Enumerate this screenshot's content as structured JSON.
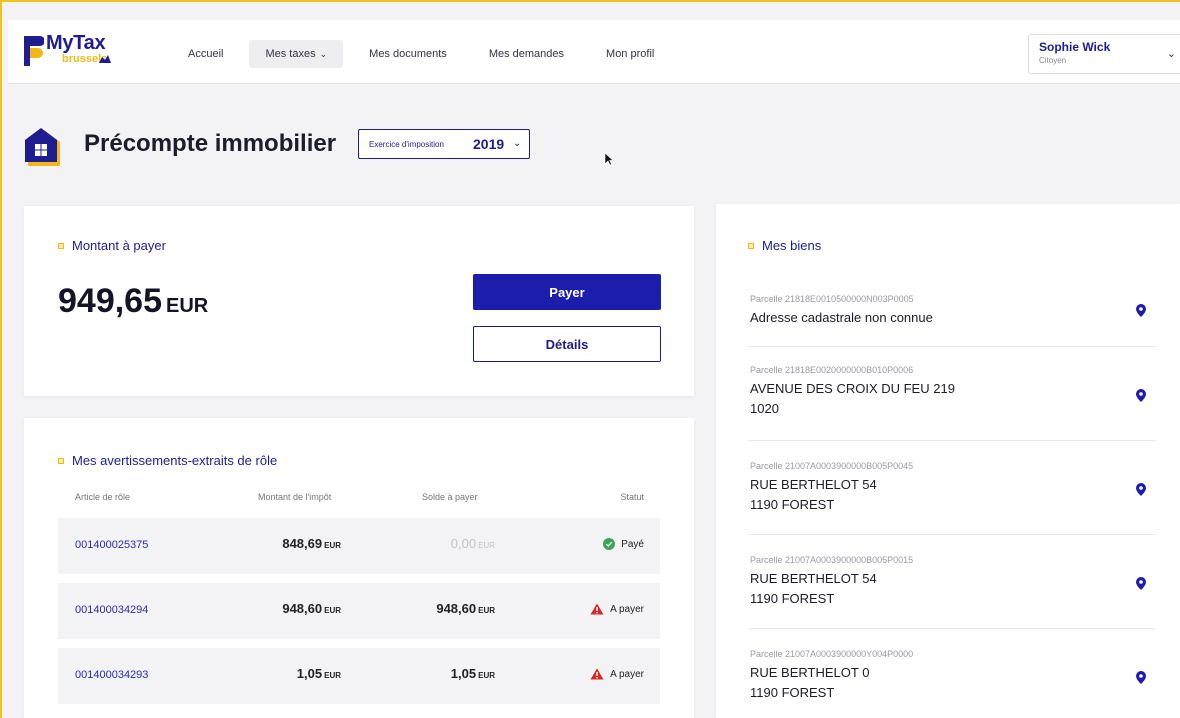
{
  "app": {
    "logo_main": "MyTax",
    "logo_sub": "brussels"
  },
  "nav": {
    "items": [
      {
        "label": "Accueil"
      },
      {
        "label": "Mes taxes"
      },
      {
        "label": "Mes documents"
      },
      {
        "label": "Mes demandes"
      },
      {
        "label": "Mon profil"
      }
    ]
  },
  "user": {
    "name": "Sophie Wick",
    "role": "Citoyen"
  },
  "page": {
    "title": "Précompte immobilier",
    "year_label": "Exercice d'imposition",
    "year_value": "2019"
  },
  "amount_card": {
    "title": "Montant à payer",
    "value": "949,65",
    "currency": "EUR",
    "pay_label": "Payer",
    "details_label": "Détails"
  },
  "role_card": {
    "title": "Mes avertissements-extraits de rôle",
    "columns": [
      "Article de rôle",
      "Montant de l'impôt",
      "Solde à payer",
      "Statut"
    ],
    "rows": [
      {
        "article": "001400025375",
        "montant": "848,69",
        "montant_unit": "EUR",
        "solde": "0,00",
        "solde_unit": "EUR",
        "statut": "Payé"
      },
      {
        "article": "001400034294",
        "montant": "948,60",
        "montant_unit": "EUR",
        "solde": "948,60",
        "solde_unit": "EUR",
        "statut": "A payer"
      },
      {
        "article": "001400034293",
        "montant": "1,05",
        "montant_unit": "EUR",
        "solde": "1,05",
        "solde_unit": "EUR",
        "statut": "A payer"
      }
    ]
  },
  "biens_card": {
    "title": "Mes biens",
    "items": [
      {
        "parcel": "Parcelle 21818E0010500000N003P0005",
        "line1": "Adresse cadastrale non connue",
        "line2": ""
      },
      {
        "parcel": "Parcelle 21818E0020000000B010P0006",
        "line1": "AVENUE DES CROIX DU FEU 219",
        "line2": "1020"
      },
      {
        "parcel": "Parcelle 21007A0003900000B005P0045",
        "line1": "RUE BERTHELOT 54",
        "line2": "1190 FOREST"
      },
      {
        "parcel": "Parcelle 21007A0003900000B005P0015",
        "line1": "RUE BERTHELOT 54",
        "line2": "1190 FOREST"
      },
      {
        "parcel": "Parcelle 21007A0003900000Y004P0000",
        "line1": "RUE BERTHELOT 0",
        "line2": "1190 FOREST"
      }
    ]
  },
  "colors": {
    "brand_blue": "#1d1dac",
    "accent_yellow": "#f0b81b",
    "paid_green": "#3aa655",
    "warning_red": "#d42a2a"
  },
  "icons": {
    "logo": "mytax-logo-icon",
    "house": "house-icon",
    "pin": "location-pin-icon",
    "paid": "check-circle-icon",
    "warning": "warning-triangle-icon",
    "chevron": "chevron-down-icon"
  }
}
